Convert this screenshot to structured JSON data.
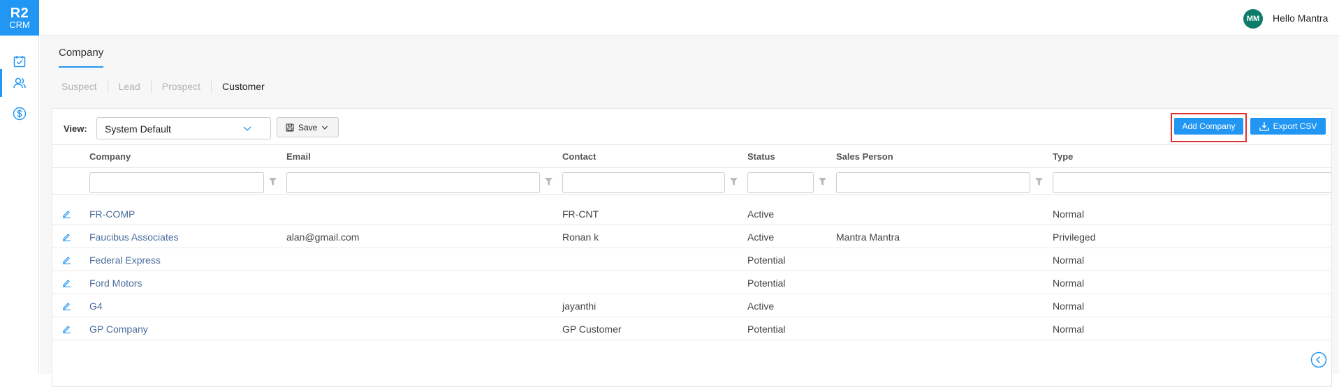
{
  "app": {
    "logo_line1": "R2",
    "logo_line2": "CRM"
  },
  "sidebar": {
    "items": [
      {
        "name": "tasks",
        "icon": "calendar-check-icon",
        "active": false
      },
      {
        "name": "contacts",
        "icon": "users-icon",
        "active": true
      },
      {
        "name": "sales",
        "icon": "dollar-icon",
        "active": false
      }
    ]
  },
  "header": {
    "avatar_initials": "MM",
    "greeting": "Hello Mantra",
    "logout_icon": "logout-icon"
  },
  "page": {
    "title": "Company",
    "subtabs": [
      {
        "label": "Suspect",
        "active": false
      },
      {
        "label": "Lead",
        "active": false
      },
      {
        "label": "Prospect",
        "active": false
      },
      {
        "label": "Customer",
        "active": true
      }
    ]
  },
  "toolbar": {
    "view_label": "View:",
    "view_value": "System Default",
    "save_label": "Save",
    "add_company_label": "Add Company",
    "export_csv_label": "Export CSV"
  },
  "table": {
    "columns": [
      "Company",
      "Email",
      "Contact",
      "Status",
      "Sales Person",
      "Type"
    ],
    "rows": [
      {
        "company": "FR-COMP",
        "email": "",
        "contact": "FR-CNT",
        "status": "Active",
        "sales_person": "",
        "type": "Normal"
      },
      {
        "company": "Faucibus Associates",
        "email": "alan@gmail.com",
        "contact": "Ronan k",
        "status": "Active",
        "sales_person": "Mantra Mantra",
        "type": "Privileged"
      },
      {
        "company": "Federal Express",
        "email": "",
        "contact": "",
        "status": "Potential",
        "sales_person": "",
        "type": "Normal"
      },
      {
        "company": "Ford Motors",
        "email": "",
        "contact": "",
        "status": "Potential",
        "sales_person": "",
        "type": "Normal"
      },
      {
        "company": "G4",
        "email": "",
        "contact": "jayanthi",
        "status": "Active",
        "sales_person": "",
        "type": "Normal"
      },
      {
        "company": "GP Company",
        "email": "",
        "contact": "GP Customer",
        "status": "Potential",
        "sales_person": "",
        "type": "Normal"
      }
    ]
  },
  "colors": {
    "accent": "#2196f3",
    "avatar": "#0e7c6b",
    "highlight": "#e03131",
    "link": "#4a6d9c"
  }
}
